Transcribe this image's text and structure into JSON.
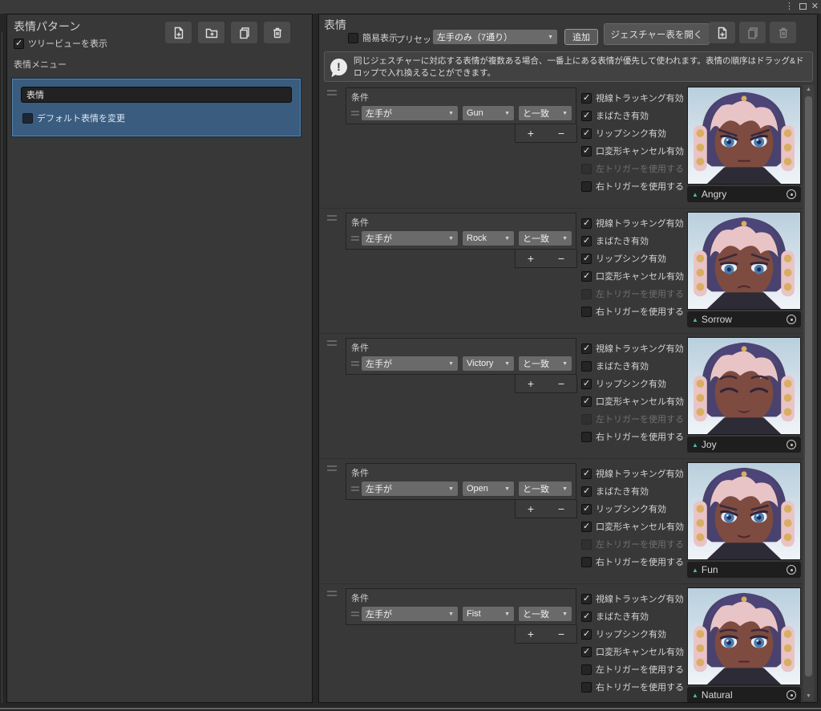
{
  "window": {
    "menu_icon": "⋮",
    "close_icon": "✕"
  },
  "colors": {
    "selection_blue": "#3a5c7f",
    "clip_triangle_teal": "#4cbd9c",
    "panel_gray": "#383838"
  },
  "left_panel": {
    "title": "表情パターン",
    "toolbar_icons": [
      "new-document-icon",
      "new-folder-icon",
      "duplicate-icon",
      "delete-icon"
    ],
    "treeview_checkbox_label": "ツリービューを表示",
    "treeview_checked": true,
    "menu_label": "表情メニュー",
    "selected_item": {
      "name_value": "表情",
      "default_change_label": "デフォルト表情を変更",
      "default_change_checked": false
    }
  },
  "right_panel": {
    "title": "表情",
    "simple_view_label": "簡易表示",
    "simple_view_checked": false,
    "preset_label": "プリセット",
    "preset_value": "左手のみ（7通り）",
    "add_button_label": "追加",
    "open_gesture_table_label": "ジェスチャー表を開く",
    "toolbar_icons": [
      "new-document-icon",
      "duplicate-icon",
      "delete-icon"
    ],
    "info_text": "同じジェスチャーに対応する表情が複数ある場合、一番上にある表情が優先して使われます。表情の順序はドラッグ&ドロップで入れ換えることができます。",
    "condition_label": "条件",
    "left_hand_value": "左手が",
    "match_value": "と一致",
    "plus_label": "+",
    "minus_label": "−",
    "checkbox_labels": [
      "視線トラッキング有効",
      "まばたき有効",
      "リップシンク有効",
      "口変形キャンセル有効",
      "左トリガーを使用する",
      "右トリガーを使用する"
    ],
    "rows": [
      {
        "gesture": "Gun",
        "expression": "Angry",
        "face": "angry",
        "checks": [
          true,
          true,
          true,
          true,
          false,
          false
        ],
        "disabled": [
          false,
          false,
          false,
          false,
          true,
          false
        ]
      },
      {
        "gesture": "Rock",
        "expression": "Sorrow",
        "face": "sorrow",
        "checks": [
          true,
          true,
          true,
          true,
          false,
          false
        ],
        "disabled": [
          false,
          false,
          false,
          false,
          true,
          false
        ]
      },
      {
        "gesture": "Victory",
        "expression": "Joy",
        "face": "joy",
        "checks": [
          true,
          false,
          true,
          true,
          false,
          false
        ],
        "disabled": [
          false,
          false,
          false,
          false,
          true,
          false
        ]
      },
      {
        "gesture": "Open",
        "expression": "Fun",
        "face": "fun",
        "checks": [
          true,
          true,
          true,
          true,
          false,
          false
        ],
        "disabled": [
          false,
          false,
          false,
          false,
          true,
          false
        ]
      },
      {
        "gesture": "Fist",
        "expression": "Natural",
        "face": "natural",
        "checks": [
          true,
          true,
          true,
          true,
          false,
          false
        ],
        "disabled": [
          false,
          false,
          false,
          false,
          false,
          false
        ]
      }
    ]
  }
}
